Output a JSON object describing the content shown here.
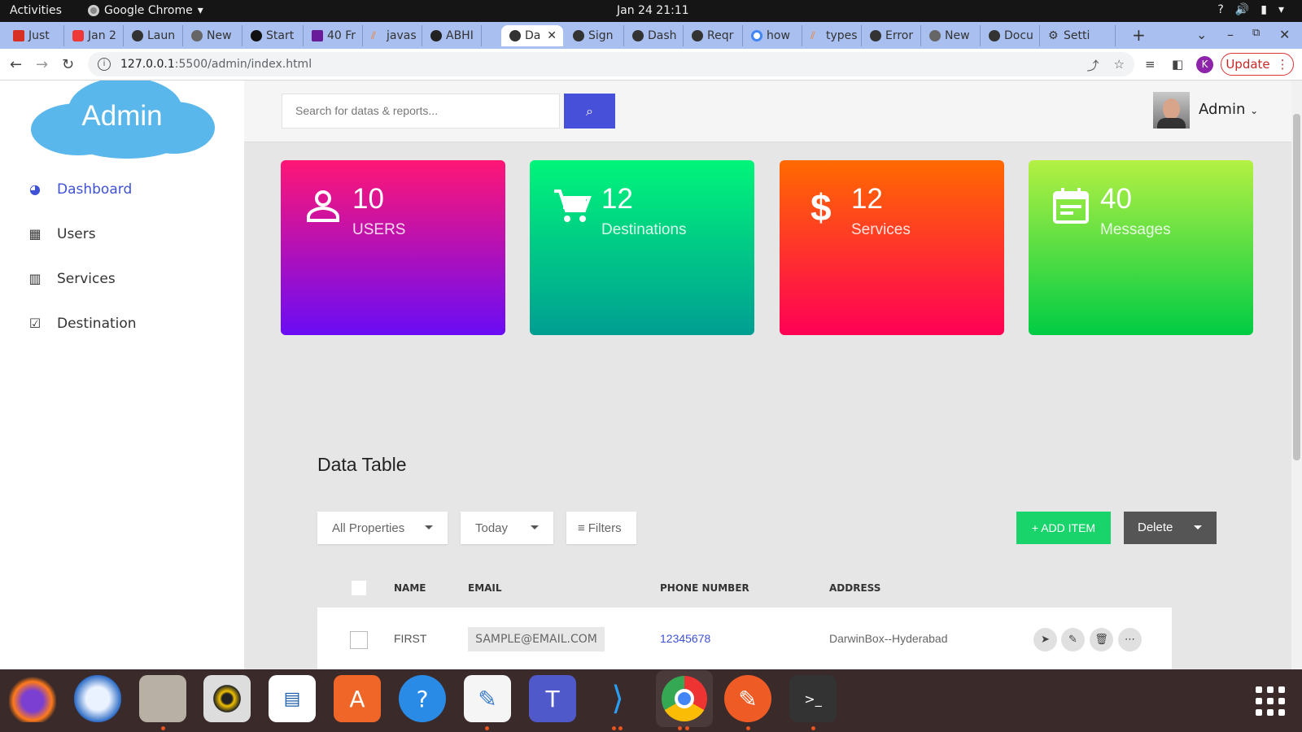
{
  "os": {
    "activities": "Activities",
    "app_name": "Google Chrome",
    "clock": "Jan 24  21:11"
  },
  "browser": {
    "tabs": [
      {
        "label": "Just",
        "icon": "gmail-icon"
      },
      {
        "label": "Jan 2",
        "icon": "vivaldi-icon"
      },
      {
        "label": "Laun",
        "icon": "globe-icon"
      },
      {
        "label": "New",
        "icon": "chrome-icon"
      },
      {
        "label": "Start",
        "icon": "shield-icon"
      },
      {
        "label": "40 Fr",
        "icon": "colorlib-icon"
      },
      {
        "label": "javas",
        "icon": "stackoverflow-icon"
      },
      {
        "label": "ABHI",
        "icon": "github-icon"
      },
      {
        "label": "Da",
        "icon": "globe-icon",
        "active": true
      },
      {
        "label": "Sign",
        "icon": "globe-icon"
      },
      {
        "label": "Dash",
        "icon": "globe-icon"
      },
      {
        "label": "Reqr",
        "icon": "globe-icon"
      },
      {
        "label": "how",
        "icon": "google-icon"
      },
      {
        "label": "types",
        "icon": "stackoverflow-icon"
      },
      {
        "label": "Error",
        "icon": "globe-icon"
      },
      {
        "label": "New",
        "icon": "chrome-icon"
      },
      {
        "label": "Docu",
        "icon": "globe-icon"
      },
      {
        "label": "Setti",
        "icon": "gear-icon"
      }
    ],
    "url_host": "127.0.0.1",
    "url_rest": ":5500/admin/index.html",
    "profile_initial": "K",
    "update_label": "Update"
  },
  "sidebar": {
    "logo_text": "Admin",
    "items": [
      {
        "label": "Dashboard",
        "icon": "dashboard-icon",
        "active": true
      },
      {
        "label": "Users",
        "icon": "table-icon"
      },
      {
        "label": "Services",
        "icon": "bar-chart-icon"
      },
      {
        "label": "Destination",
        "icon": "checkbox-icon"
      }
    ]
  },
  "header": {
    "search_placeholder": "Search for datas & reports...",
    "user_name": "Admin"
  },
  "cards": [
    {
      "value": "10",
      "label": "USERS",
      "icon": "user-icon",
      "colors": [
        "#ff1675",
        "#6a0cf5"
      ]
    },
    {
      "value": "12",
      "label": "Destinations",
      "icon": "cart-icon",
      "colors": [
        "#00f57a",
        "#009e92"
      ]
    },
    {
      "value": "12",
      "label": "Services",
      "icon": "dollar-icon",
      "colors": [
        "#ff6a00",
        "#ff0055"
      ]
    },
    {
      "value": "40",
      "label": "Messages",
      "icon": "calendar-icon",
      "colors": [
        "#b4f043",
        "#00cc44"
      ]
    }
  ],
  "table": {
    "title": "Data Table",
    "filters": {
      "property": "All Properties",
      "date": "Today",
      "filters": "Filters"
    },
    "add_label": "+ ADD ITEM",
    "delete_label": "Delete",
    "columns": [
      "NAME",
      "EMAIL",
      "PHONE NUMBER",
      "ADDRESS"
    ],
    "rows": [
      {
        "name": "FIRST",
        "email": "SAMPLE@EMAIL.COM",
        "phone": "12345678",
        "address": "DarwinBox--Hyderabad"
      }
    ]
  }
}
